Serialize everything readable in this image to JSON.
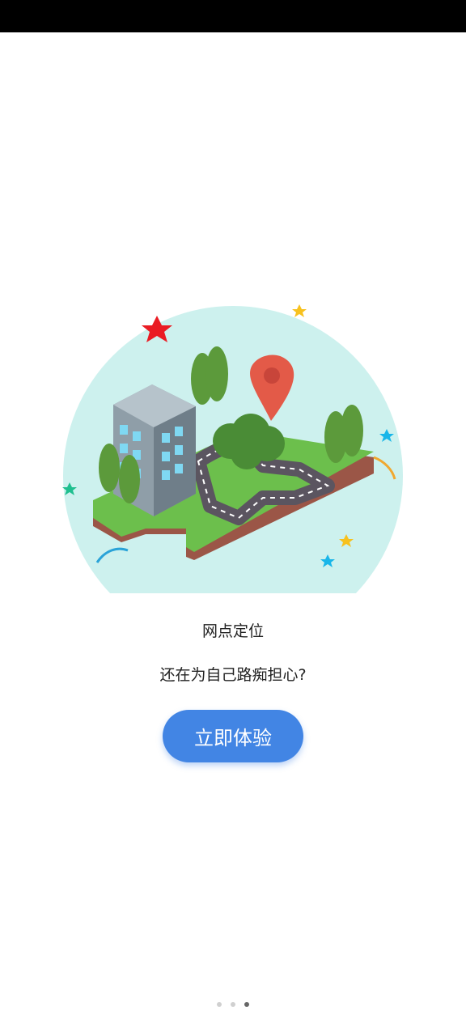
{
  "illustration": {
    "background_color": "#cdf1ee",
    "road_color": "#5b5560",
    "grass_color": "#6cbf4c",
    "pin_color": "#e35a48",
    "icon": "city-map-location-illustration"
  },
  "content": {
    "title": "网点定位",
    "subtitle": "还在为自己路痴担心?"
  },
  "cta": {
    "label": "立即体验",
    "color": "#4285e4"
  },
  "pager": {
    "total": 3,
    "current": 3
  }
}
